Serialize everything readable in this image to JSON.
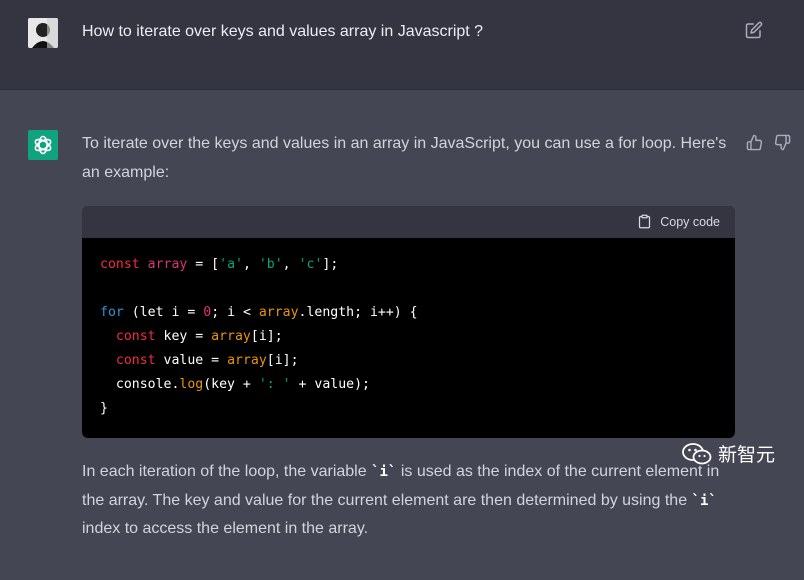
{
  "user_message": {
    "text": "How to iterate over keys and values array in Javascript ?"
  },
  "assistant": {
    "intro": "To iterate over the keys and values in an array in JavaScript, you can use a for loop. Here's an example:",
    "code_block": {
      "copy_label": "Copy code"
    },
    "outro_parts": [
      "In each iteration of the loop, the variable ",
      "`i`",
      " is used as the index of the current element in the array. The key and value for the current element are then determined by using the ",
      "`i`",
      " index to access the element in the array."
    ]
  },
  "watermark": {
    "text": "新智元"
  },
  "colors": {
    "user_bg": "#343541",
    "assistant_bg": "#444654",
    "brand_green": "#10a37f"
  }
}
